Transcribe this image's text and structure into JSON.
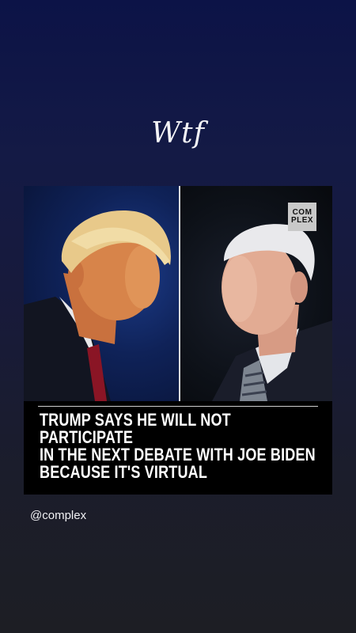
{
  "story": {
    "caption": "Wtf",
    "handle": "@complex"
  },
  "post": {
    "brand_logo_lines": [
      "COM",
      "PLEX"
    ],
    "headline_lines": [
      "TRUMP SAYS HE WILL NOT PARTICIPATE",
      "IN THE NEXT DEBATE WITH JOE BIDEN",
      "BECAUSE IT'S VIRTUAL"
    ]
  },
  "colors": {
    "background_top": "#0c1347",
    "background_bottom": "#1d1e24",
    "headline": "#ffffff",
    "logo_bg": "#c9c9c9"
  }
}
